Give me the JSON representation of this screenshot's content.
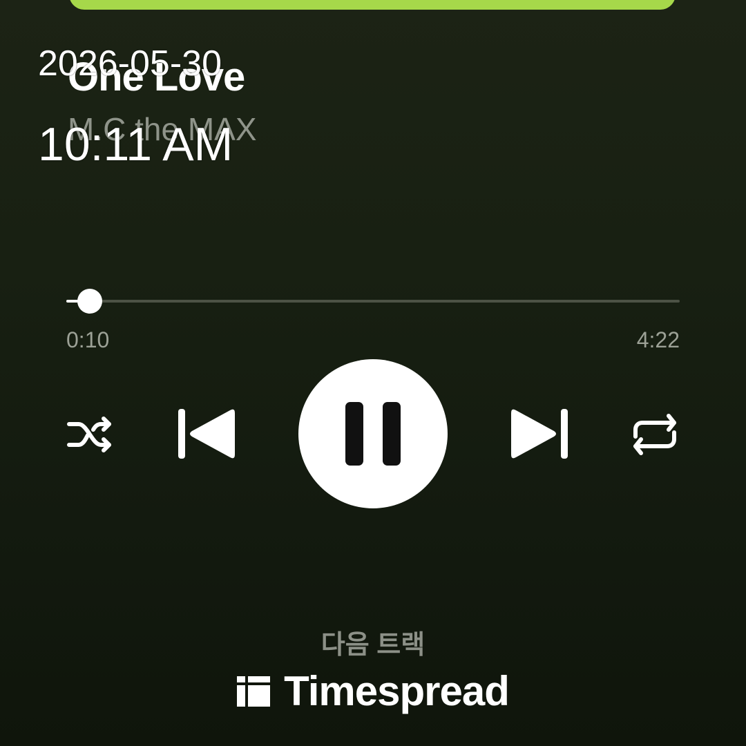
{
  "track": {
    "title": "One Love",
    "artist": "M.C the MAX"
  },
  "overlay": {
    "date": "2026-05-30",
    "time": "10:11 AM"
  },
  "playback": {
    "elapsed": "0:10",
    "total": "4:22",
    "progress_fraction": 0.038,
    "state": "playing"
  },
  "controls": {
    "shuffle_icon": "shuffle-icon",
    "previous_icon": "skip-previous-icon",
    "pause_icon": "pause-icon",
    "next_icon": "skip-next-icon",
    "repeat_icon": "repeat-icon"
  },
  "next_track": {
    "label": "다음 트랙"
  },
  "watermark": {
    "text": "Timespread"
  },
  "colors": {
    "accent": "#ffffff",
    "album_art": "#a6d84a",
    "muted_text": "#8f948a"
  }
}
